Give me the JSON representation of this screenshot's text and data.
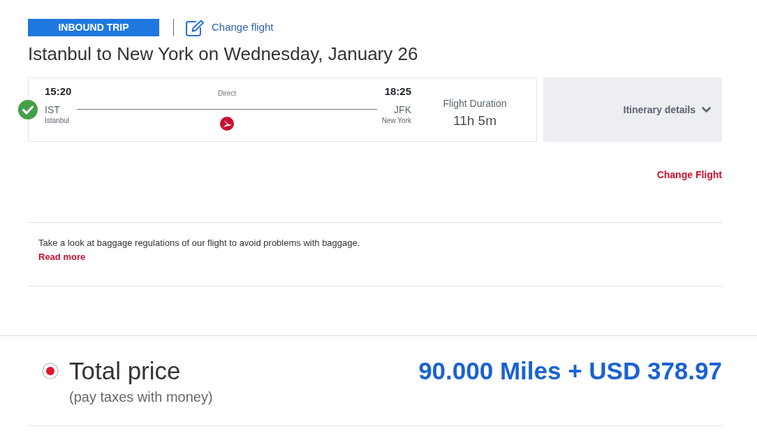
{
  "trip_header": {
    "badge": "INBOUND TRIP",
    "change_link": "Change flight"
  },
  "title": "Istanbul to New York on Wednesday, January 26",
  "flight": {
    "selected": true,
    "departure": {
      "time": "15:20",
      "code": "IST",
      "city": "Istanbul"
    },
    "stops": "Direct",
    "arrival": {
      "time": "18:25",
      "code": "JFK",
      "city": "New York"
    },
    "duration_label": "Flight Duration",
    "duration": "11h 5m"
  },
  "itinerary": {
    "label": "Itinerary details",
    "expanded": false
  },
  "change_flight": "Change Flight",
  "baggage": {
    "text": "Take a look at baggage regulations of our flight to avoid problems with baggage.",
    "link": "Read more"
  },
  "price": {
    "selected": true,
    "label": "Total price",
    "note": "(pay taxes with money)",
    "amount": "90.000 Miles + USD 378.97"
  }
}
